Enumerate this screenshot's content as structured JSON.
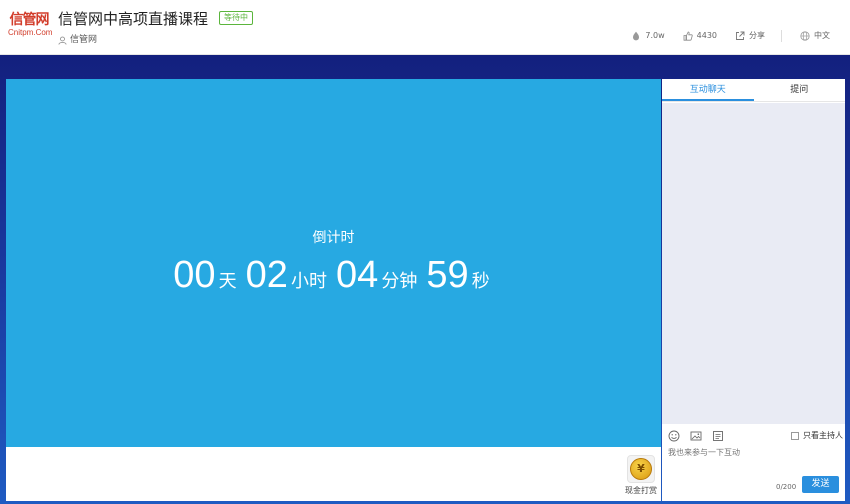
{
  "header": {
    "logo_main": "信管网",
    "logo_sub": "Cnitpm.Com",
    "title": "信管网中高项直播课程",
    "status_badge": "等待中",
    "author": "信管网",
    "stats": {
      "views": "7.0w",
      "likes": "4430",
      "share": "分享",
      "language": "中文"
    }
  },
  "video": {
    "countdown_label": "倒计时",
    "countdown": [
      {
        "value": "00",
        "unit": "天"
      },
      {
        "value": "02",
        "unit": "小时"
      },
      {
        "value": "04",
        "unit": "分钟"
      },
      {
        "value": "59",
        "unit": "秒"
      }
    ],
    "reward_label": "现金打赏",
    "reward_symbol": "¥"
  },
  "chat": {
    "tabs": [
      {
        "label": "互动聊天",
        "active": true
      },
      {
        "label": "提问",
        "active": false
      }
    ],
    "host_only_label": "只看主持人",
    "input_placeholder": "我也来参与一下互动",
    "char_counter": "0/200",
    "send_label": "发送"
  },
  "colors": {
    "video_bg": "#27a9e2",
    "accent": "#2a8fde",
    "backdrop": "#13207e",
    "badge": "#5bb53c",
    "logo": "#d23d2b"
  }
}
